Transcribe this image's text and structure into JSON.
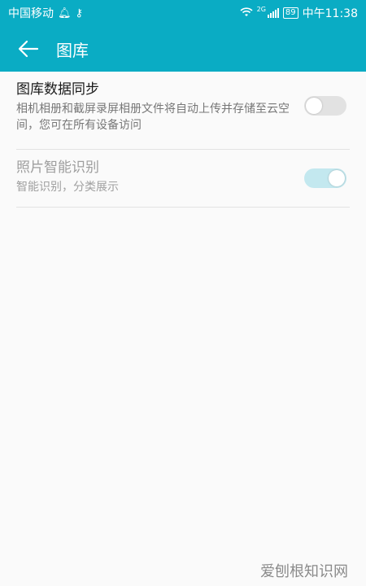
{
  "status_bar": {
    "carrier": "中国移动",
    "network_tag": "2G",
    "battery": "89",
    "time": "中午11:38"
  },
  "app_bar": {
    "title": "图库"
  },
  "settings": [
    {
      "title": "图库数据同步",
      "description": "相机相册和截屏录屏相册文件将自动上传并存储至云空间，您可在所有设备访问",
      "enabled": false
    },
    {
      "title": "照片智能识别",
      "description": "智能识别，分类展示",
      "enabled": true,
      "disabled": true
    }
  ],
  "watermark": "爱刨根知识网",
  "colors": {
    "accent": "#0aacc4",
    "toggle_off": "#e2e2e2",
    "toggle_on_disabled": "#c3e8ef"
  }
}
